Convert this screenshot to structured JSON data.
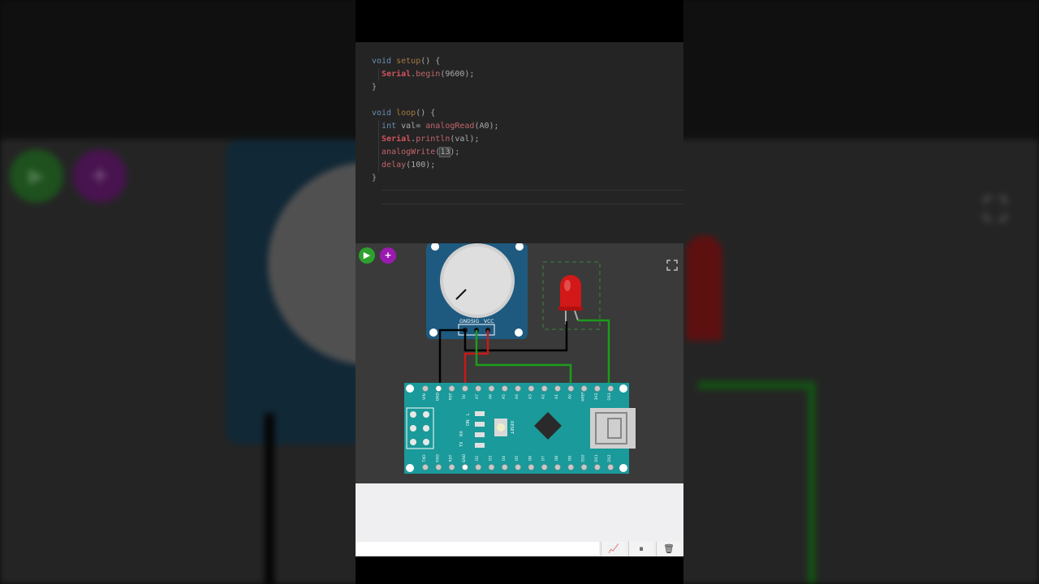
{
  "editor": {
    "lines": [
      {
        "tokens": [
          {
            "t": "void ",
            "c": "kw"
          },
          {
            "t": "setup",
            "c": "fn"
          },
          {
            "t": "() {",
            "c": "ident"
          }
        ]
      },
      {
        "tokens": [
          {
            "t": "  "
          },
          {
            "t": "Serial",
            "c": "obj"
          },
          {
            "t": ".",
            "c": "ident"
          },
          {
            "t": "begin",
            "c": "meth"
          },
          {
            "t": "(9600);",
            "c": "ident"
          }
        ]
      },
      {
        "tokens": [
          {
            "t": "}",
            "c": "ident"
          }
        ]
      },
      {
        "tokens": []
      },
      {
        "tokens": [
          {
            "t": "void ",
            "c": "kw"
          },
          {
            "t": "loop",
            "c": "fn"
          },
          {
            "t": "() {",
            "c": "ident"
          }
        ]
      },
      {
        "tokens": [
          {
            "t": "  "
          },
          {
            "t": "int ",
            "c": "kw"
          },
          {
            "t": "val= ",
            "c": "ident"
          },
          {
            "t": "analogRead",
            "c": "meth"
          },
          {
            "t": "(A0);",
            "c": "ident"
          }
        ]
      },
      {
        "tokens": [
          {
            "t": "  "
          },
          {
            "t": "Serial",
            "c": "obj"
          },
          {
            "t": ".",
            "c": "ident"
          },
          {
            "t": "println",
            "c": "meth"
          },
          {
            "t": "(val);",
            "c": "ident"
          }
        ]
      },
      {
        "tokens": [
          {
            "t": "  "
          },
          {
            "t": "analogWrite",
            "c": "meth"
          },
          {
            "t": "(",
            "c": "ident"
          },
          {
            "t": "13",
            "c": "ident sel"
          },
          {
            "t": ");",
            "c": "ident"
          }
        ]
      },
      {
        "tokens": [
          {
            "t": "  "
          },
          {
            "t": "delay",
            "c": "meth"
          },
          {
            "t": "(100);",
            "c": "ident"
          }
        ]
      },
      {
        "tokens": [
          {
            "t": "}",
            "c": "ident"
          }
        ]
      }
    ]
  },
  "sim": {
    "play_icon": "play-icon",
    "add_icon": "plus-icon",
    "expand_icon": "fullscreen-icon",
    "pot_pins": [
      "GND",
      "SIG",
      "VCC"
    ],
    "top_pins": [
      "VIN",
      "GND",
      "RST",
      "5V",
      "A7",
      "A6",
      "A5",
      "A4",
      "A3",
      "A2",
      "A1",
      "A0",
      "AREF",
      "3V3",
      "D13"
    ],
    "bottom_pins": [
      "TXD",
      "RXD",
      "RST",
      "GND",
      "D2",
      "D3",
      "D4",
      "D5",
      "D6",
      "D7",
      "D8",
      "D9",
      "D10",
      "D11",
      "D12"
    ],
    "board_labels": [
      "L",
      "ON",
      "RX",
      "TX",
      "RESET"
    ],
    "colors": {
      "board": "#1a9a9a",
      "wire_green": "#1c9c1c",
      "wire_red": "#c81818",
      "wire_black": "#000000",
      "led": "#d21818",
      "pot_board": "#1e5a80"
    }
  },
  "serial": {
    "buttons": [
      {
        "name": "chart-button",
        "icon": "chart-icon",
        "glyph": "📈"
      },
      {
        "name": "pause-button",
        "icon": "pause-icon",
        "glyph": "⏸"
      },
      {
        "name": "clear-button",
        "icon": "trash-icon",
        "glyph": "🗑"
      }
    ]
  }
}
